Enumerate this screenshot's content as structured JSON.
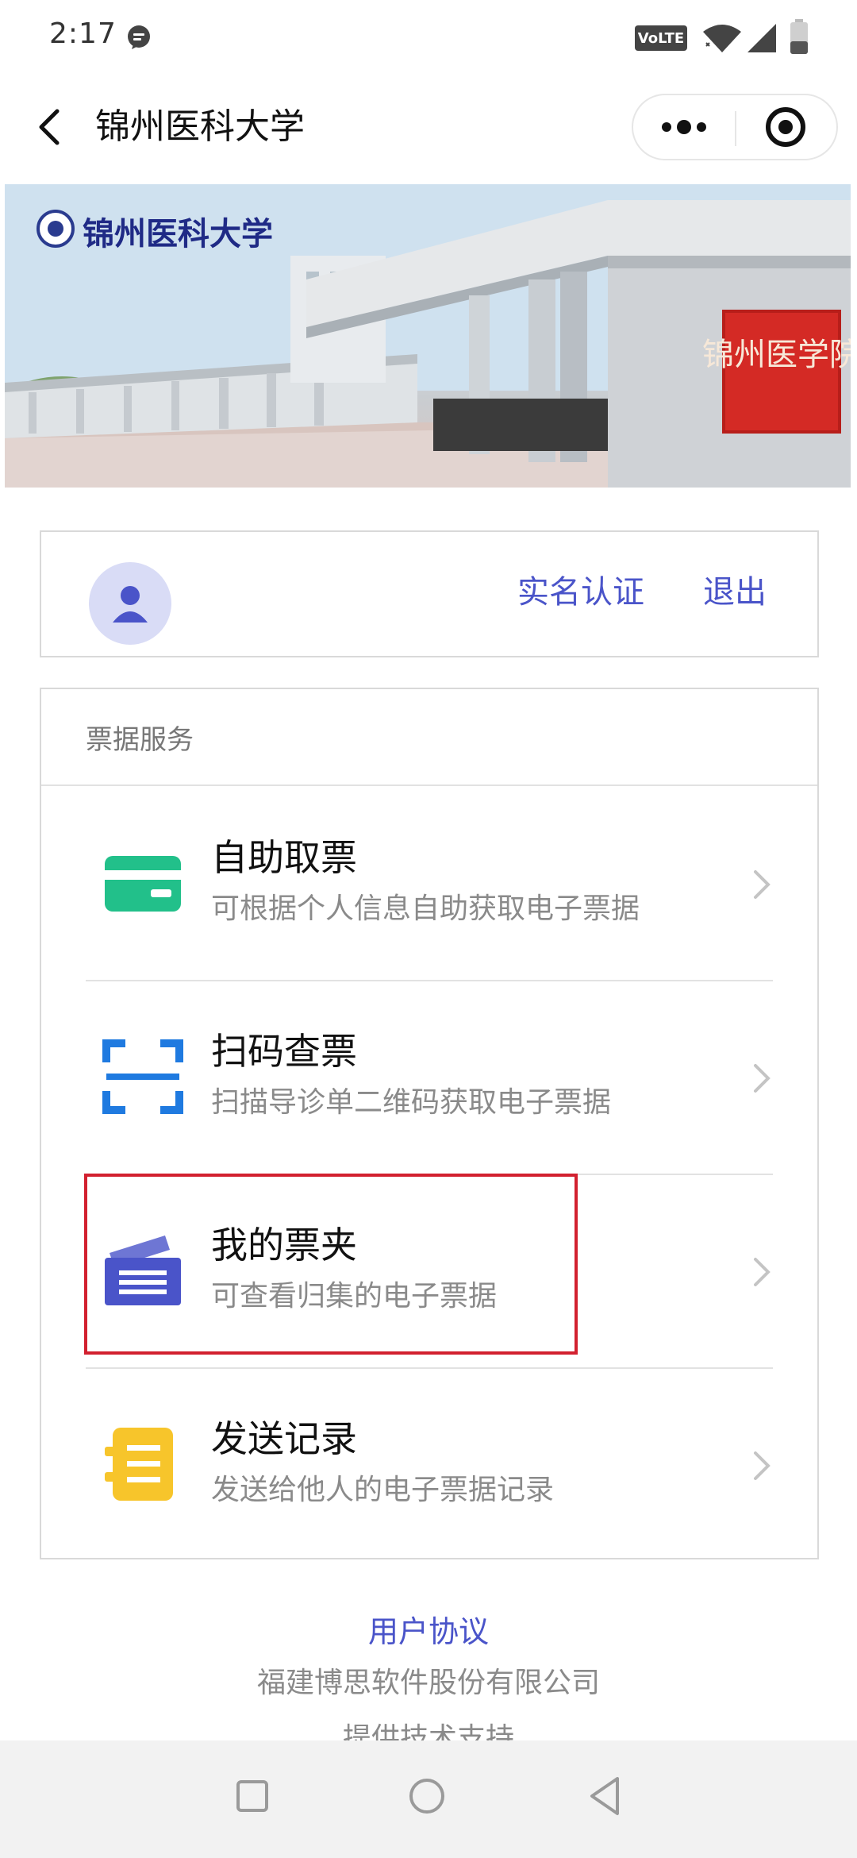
{
  "status_bar": {
    "time": "2:17",
    "network_badge": "VoLTE"
  },
  "nav": {
    "title": "锦州医科大学"
  },
  "banner": {
    "school_name": "锦州医科大学",
    "seal_text": "锦州医学院"
  },
  "user_card": {
    "verify_label": "实名认证",
    "logout_label": "退出"
  },
  "services": {
    "section_title": "票据服务",
    "items": [
      {
        "title": "自助取票",
        "desc": "可根据个人信息自助获取电子票据",
        "icon": "card-icon"
      },
      {
        "title": "扫码查票",
        "desc": "扫描导诊单二维码获取电子票据",
        "icon": "scan-icon"
      },
      {
        "title": "我的票夹",
        "desc": "可查看归集的电子票据",
        "icon": "ticket-folder-icon"
      },
      {
        "title": "发送记录",
        "desc": "发送给他人的电子票据记录",
        "icon": "record-icon"
      }
    ]
  },
  "footer": {
    "agreement_label": "用户协议",
    "company": "福建博思软件股份有限公司",
    "support": "提供技术支持"
  },
  "colors": {
    "accent": "#4a54c9",
    "card_green": "#22c08a",
    "scan_blue": "#1f7ae0",
    "folder_indigo": "#4a54c9",
    "record_yellow": "#f7c52b",
    "highlight_red": "#d2202f"
  }
}
